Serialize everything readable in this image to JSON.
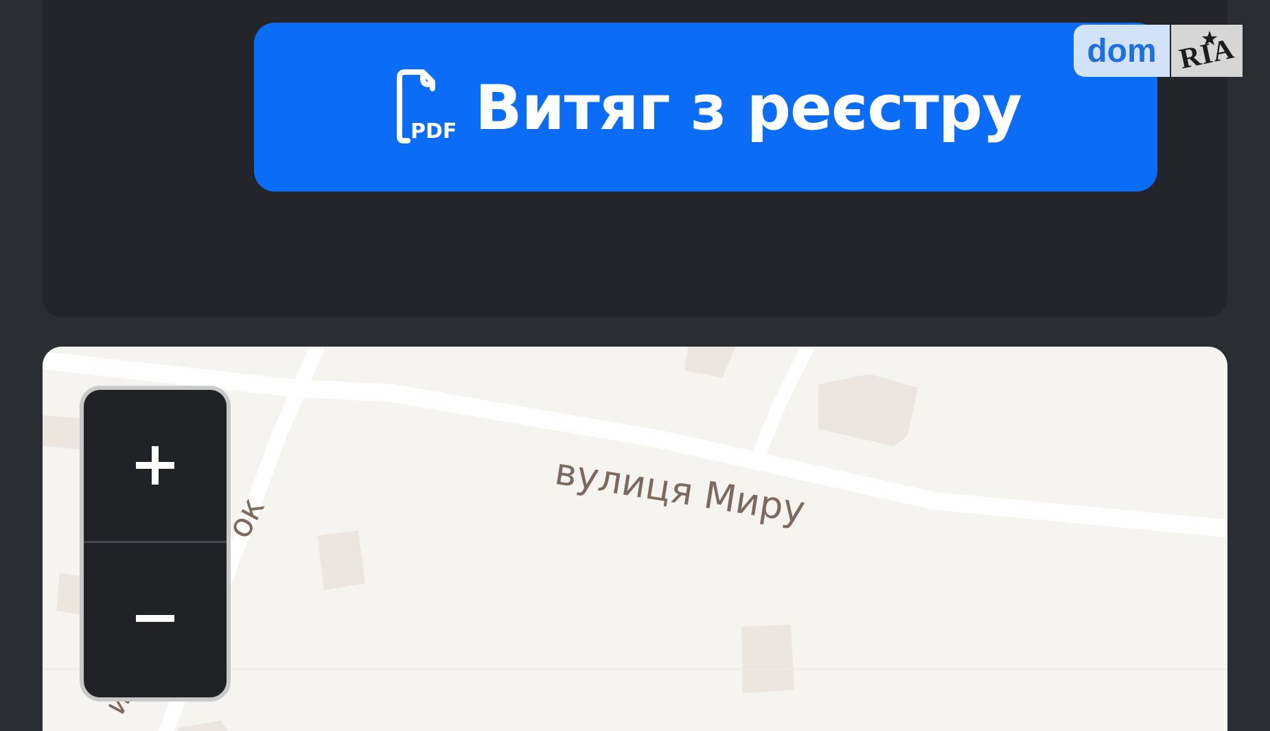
{
  "registry_button": {
    "label": "Витяг з реєстру",
    "icon": "pdf-file-icon",
    "icon_text": "PDF",
    "color": "#0a6cf7"
  },
  "logo": {
    "dom_text": "dom",
    "ria_text": "RIA",
    "dom_color": "#1f6fe0"
  },
  "map": {
    "street_labels": [
      "вулиця Миру",
      "ок",
      "и"
    ],
    "zoom_in_icon": "plus-icon",
    "zoom_out_icon": "minus-icon"
  },
  "theme": {
    "background": "#2a2d32",
    "card": "#23252a",
    "map_background": "#f6f4f1"
  }
}
